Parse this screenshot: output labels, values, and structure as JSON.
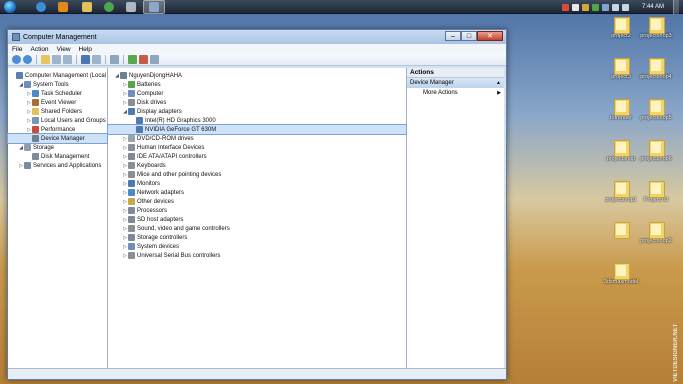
{
  "taskbar": {
    "clock": "7:44 AM",
    "icons": [
      "start-orb",
      "ie-icon",
      "media-player-icon",
      "explorer-icon",
      "chrome-icon",
      "games-icon",
      "network-icon",
      "computer-management-icon"
    ]
  },
  "desktop": {
    "icons": [
      {
        "label": "project2",
        "col": 0,
        "row": 0
      },
      {
        "label": "projectshop3",
        "col": 1,
        "row": 0
      },
      {
        "label": "project3",
        "col": 0,
        "row": 1
      },
      {
        "label": "projectshop4",
        "col": 1,
        "row": 1
      },
      {
        "label": "tutrender",
        "col": 0,
        "row": 2
      },
      {
        "label": "projectshop5",
        "col": 1,
        "row": 2
      },
      {
        "label": "projectshop",
        "col": 0,
        "row": 3
      },
      {
        "label": "projectshop6",
        "col": 1,
        "row": 3
      },
      {
        "label": "projectshop1",
        "col": 0,
        "row": 4
      },
      {
        "label": "ProjectTU",
        "col": 1,
        "row": 4
      },
      {
        "label": "",
        "col": 0,
        "row": 5
      },
      {
        "label": "projectshop2",
        "col": 1,
        "row": 5
      },
      {
        "label": "3dsmaxmodel",
        "col": 0,
        "row": 6
      }
    ],
    "watermark": "VIETDESIGNER.NET"
  },
  "window": {
    "title": "Computer Management",
    "menu": [
      "File",
      "Action",
      "View",
      "Help"
    ],
    "buttons": {
      "minimize": "–",
      "maximize": "□",
      "close": "✕"
    },
    "tree": [
      {
        "label": "Computer Management (Local",
        "level": 0,
        "exp": "",
        "color": "#5a7fb0"
      },
      {
        "label": "System Tools",
        "level": 1,
        "exp": "◢",
        "color": "#6d8fb9"
      },
      {
        "label": "Task Scheduler",
        "level": 2,
        "exp": "▷",
        "color": "#4c8ac7"
      },
      {
        "label": "Event Viewer",
        "level": 2,
        "exp": "▷",
        "color": "#a86f33"
      },
      {
        "label": "Shared Folders",
        "level": 2,
        "exp": "▷",
        "color": "#e3c15a"
      },
      {
        "label": "Local Users and Groups",
        "level": 2,
        "exp": "▷",
        "color": "#7a93b4"
      },
      {
        "label": "Performance",
        "level": 2,
        "exp": "▷",
        "color": "#d04a3a"
      },
      {
        "label": "Device Manager",
        "level": 2,
        "exp": "",
        "color": "#6b7f95",
        "selected": true
      },
      {
        "label": "Storage",
        "level": 1,
        "exp": "◢",
        "color": "#8e9eb3"
      },
      {
        "label": "Disk Management",
        "level": 2,
        "exp": "",
        "color": "#7c8a9c"
      },
      {
        "label": "Services and Applications",
        "level": 1,
        "exp": "▷",
        "color": "#7a8ca5"
      }
    ],
    "devices": [
      {
        "label": "NguyenDjongHAHA",
        "level": 0,
        "exp": "◢",
        "color": "#6b7f95"
      },
      {
        "label": "Batteries",
        "level": 1,
        "exp": "▷",
        "color": "#58a34a"
      },
      {
        "label": "Computer",
        "level": 1,
        "exp": "▷",
        "color": "#6d8fb9"
      },
      {
        "label": "Disk drives",
        "level": 1,
        "exp": "▷",
        "color": "#8a8f96"
      },
      {
        "label": "Display adapters",
        "level": 1,
        "exp": "◢",
        "color": "#4e79b3"
      },
      {
        "label": "Intel(R) HD Graphics 3000",
        "level": 2,
        "exp": "",
        "color": "#4e79b3"
      },
      {
        "label": "NVIDIA GeForce GT 630M",
        "level": 2,
        "exp": "",
        "color": "#4e79b3",
        "selected": true
      },
      {
        "label": "DVD/CD-ROM drives",
        "level": 1,
        "exp": "▷",
        "color": "#9aa3ad"
      },
      {
        "label": "Human Interface Devices",
        "level": 1,
        "exp": "▷",
        "color": "#8a8f96"
      },
      {
        "label": "IDE ATA/ATAPI controllers",
        "level": 1,
        "exp": "▷",
        "color": "#7f8894"
      },
      {
        "label": "Keyboards",
        "level": 1,
        "exp": "▷",
        "color": "#8a8f96"
      },
      {
        "label": "Mice and other pointing devices",
        "level": 1,
        "exp": "▷",
        "color": "#8a8f96"
      },
      {
        "label": "Monitors",
        "level": 1,
        "exp": "▷",
        "color": "#4e79b3"
      },
      {
        "label": "Network adapters",
        "level": 1,
        "exp": "▷",
        "color": "#4c8ac7"
      },
      {
        "label": "Other devices",
        "level": 1,
        "exp": "▷",
        "color": "#c9a74a"
      },
      {
        "label": "Processors",
        "level": 1,
        "exp": "▷",
        "color": "#7c8a9c"
      },
      {
        "label": "SD host adapters",
        "level": 1,
        "exp": "▷",
        "color": "#7f8894"
      },
      {
        "label": "Sound, video and game controllers",
        "level": 1,
        "exp": "▷",
        "color": "#8a8f96"
      },
      {
        "label": "Storage controllers",
        "level": 1,
        "exp": "▷",
        "color": "#7f8894"
      },
      {
        "label": "System devices",
        "level": 1,
        "exp": "▷",
        "color": "#6d8fb9"
      },
      {
        "label": "Universal Serial Bus controllers",
        "level": 1,
        "exp": "▷",
        "color": "#8a8f96"
      }
    ],
    "actions": {
      "header": "Actions",
      "selected": "Device Manager",
      "more": "More Actions"
    }
  }
}
